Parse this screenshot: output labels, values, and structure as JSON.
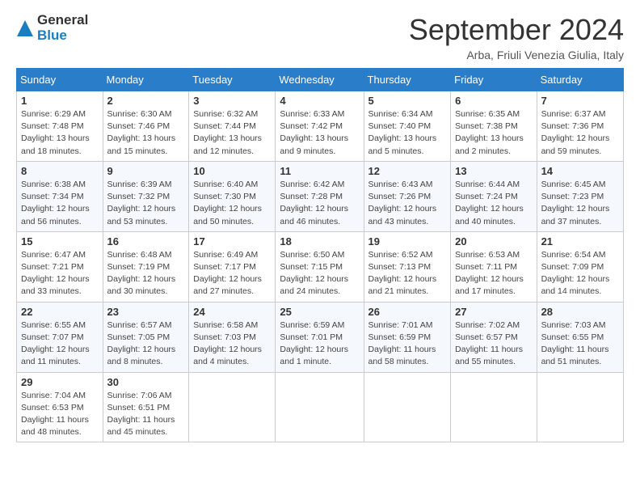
{
  "header": {
    "logo_line1": "General",
    "logo_line2": "Blue",
    "month_title": "September 2024",
    "location": "Arba, Friuli Venezia Giulia, Italy"
  },
  "days_of_week": [
    "Sunday",
    "Monday",
    "Tuesday",
    "Wednesday",
    "Thursday",
    "Friday",
    "Saturday"
  ],
  "weeks": [
    [
      {
        "day": "1",
        "sunrise": "6:29 AM",
        "sunset": "7:48 PM",
        "daylight": "13 hours and 18 minutes."
      },
      {
        "day": "2",
        "sunrise": "6:30 AM",
        "sunset": "7:46 PM",
        "daylight": "13 hours and 15 minutes."
      },
      {
        "day": "3",
        "sunrise": "6:32 AM",
        "sunset": "7:44 PM",
        "daylight": "13 hours and 12 minutes."
      },
      {
        "day": "4",
        "sunrise": "6:33 AM",
        "sunset": "7:42 PM",
        "daylight": "13 hours and 9 minutes."
      },
      {
        "day": "5",
        "sunrise": "6:34 AM",
        "sunset": "7:40 PM",
        "daylight": "13 hours and 5 minutes."
      },
      {
        "day": "6",
        "sunrise": "6:35 AM",
        "sunset": "7:38 PM",
        "daylight": "13 hours and 2 minutes."
      },
      {
        "day": "7",
        "sunrise": "6:37 AM",
        "sunset": "7:36 PM",
        "daylight": "12 hours and 59 minutes."
      }
    ],
    [
      {
        "day": "8",
        "sunrise": "6:38 AM",
        "sunset": "7:34 PM",
        "daylight": "12 hours and 56 minutes."
      },
      {
        "day": "9",
        "sunrise": "6:39 AM",
        "sunset": "7:32 PM",
        "daylight": "12 hours and 53 minutes."
      },
      {
        "day": "10",
        "sunrise": "6:40 AM",
        "sunset": "7:30 PM",
        "daylight": "12 hours and 50 minutes."
      },
      {
        "day": "11",
        "sunrise": "6:42 AM",
        "sunset": "7:28 PM",
        "daylight": "12 hours and 46 minutes."
      },
      {
        "day": "12",
        "sunrise": "6:43 AM",
        "sunset": "7:26 PM",
        "daylight": "12 hours and 43 minutes."
      },
      {
        "day": "13",
        "sunrise": "6:44 AM",
        "sunset": "7:24 PM",
        "daylight": "12 hours and 40 minutes."
      },
      {
        "day": "14",
        "sunrise": "6:45 AM",
        "sunset": "7:23 PM",
        "daylight": "12 hours and 37 minutes."
      }
    ],
    [
      {
        "day": "15",
        "sunrise": "6:47 AM",
        "sunset": "7:21 PM",
        "daylight": "12 hours and 33 minutes."
      },
      {
        "day": "16",
        "sunrise": "6:48 AM",
        "sunset": "7:19 PM",
        "daylight": "12 hours and 30 minutes."
      },
      {
        "day": "17",
        "sunrise": "6:49 AM",
        "sunset": "7:17 PM",
        "daylight": "12 hours and 27 minutes."
      },
      {
        "day": "18",
        "sunrise": "6:50 AM",
        "sunset": "7:15 PM",
        "daylight": "12 hours and 24 minutes."
      },
      {
        "day": "19",
        "sunrise": "6:52 AM",
        "sunset": "7:13 PM",
        "daylight": "12 hours and 21 minutes."
      },
      {
        "day": "20",
        "sunrise": "6:53 AM",
        "sunset": "7:11 PM",
        "daylight": "12 hours and 17 minutes."
      },
      {
        "day": "21",
        "sunrise": "6:54 AM",
        "sunset": "7:09 PM",
        "daylight": "12 hours and 14 minutes."
      }
    ],
    [
      {
        "day": "22",
        "sunrise": "6:55 AM",
        "sunset": "7:07 PM",
        "daylight": "12 hours and 11 minutes."
      },
      {
        "day": "23",
        "sunrise": "6:57 AM",
        "sunset": "7:05 PM",
        "daylight": "12 hours and 8 minutes."
      },
      {
        "day": "24",
        "sunrise": "6:58 AM",
        "sunset": "7:03 PM",
        "daylight": "12 hours and 4 minutes."
      },
      {
        "day": "25",
        "sunrise": "6:59 AM",
        "sunset": "7:01 PM",
        "daylight": "12 hours and 1 minute."
      },
      {
        "day": "26",
        "sunrise": "7:01 AM",
        "sunset": "6:59 PM",
        "daylight": "11 hours and 58 minutes."
      },
      {
        "day": "27",
        "sunrise": "7:02 AM",
        "sunset": "6:57 PM",
        "daylight": "11 hours and 55 minutes."
      },
      {
        "day": "28",
        "sunrise": "7:03 AM",
        "sunset": "6:55 PM",
        "daylight": "11 hours and 51 minutes."
      }
    ],
    [
      {
        "day": "29",
        "sunrise": "7:04 AM",
        "sunset": "6:53 PM",
        "daylight": "11 hours and 48 minutes."
      },
      {
        "day": "30",
        "sunrise": "7:06 AM",
        "sunset": "6:51 PM",
        "daylight": "11 hours and 45 minutes."
      },
      null,
      null,
      null,
      null,
      null
    ]
  ],
  "labels": {
    "sunrise": "Sunrise:",
    "sunset": "Sunset:",
    "daylight": "Daylight:"
  },
  "accent_color": "#2a7dc9"
}
